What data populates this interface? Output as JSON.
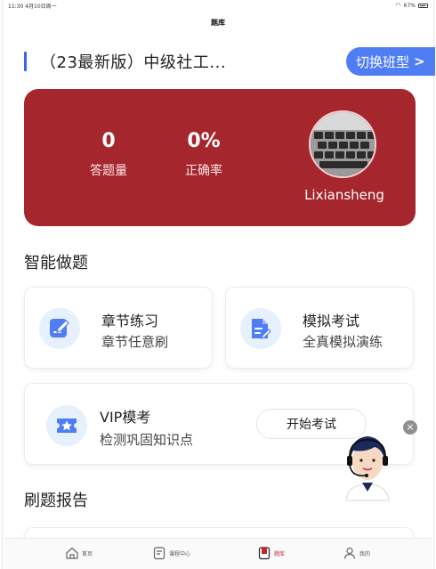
{
  "status": {
    "time": "11:30",
    "date": "4月10日周一",
    "battery": "67%"
  },
  "nav": {
    "title": "题库"
  },
  "course": {
    "title": "（23最新版）中级社工...",
    "switch_label": "切换班型"
  },
  "stats": {
    "answered_value": "0",
    "answered_label": "答题量",
    "accuracy_value": "0%",
    "accuracy_label": "正确率",
    "username": "Lixiansheng"
  },
  "sections": {
    "smart": "智能做题",
    "report": "刷题报告"
  },
  "cards": {
    "chapter": {
      "title": "章节练习",
      "sub": "章节任意刷",
      "icon": "edit-icon"
    },
    "mock": {
      "title": "模拟考试",
      "sub": "全真模拟演练",
      "icon": "document-icon"
    },
    "vip": {
      "title": "VIP模考",
      "sub": "检测巩固知识点",
      "button": "开始考试",
      "icon": "star-ticket-icon"
    }
  },
  "tabs": [
    {
      "label": "首页",
      "icon": "home-icon"
    },
    {
      "label": "课程中心",
      "icon": "course-icon"
    },
    {
      "label": "题库",
      "icon": "question-bank-icon"
    },
    {
      "label": "我的",
      "icon": "user-icon"
    }
  ],
  "colors": {
    "accent": "#4f7df3",
    "card_red": "#a5262d",
    "active_tab": "#c0262d"
  }
}
